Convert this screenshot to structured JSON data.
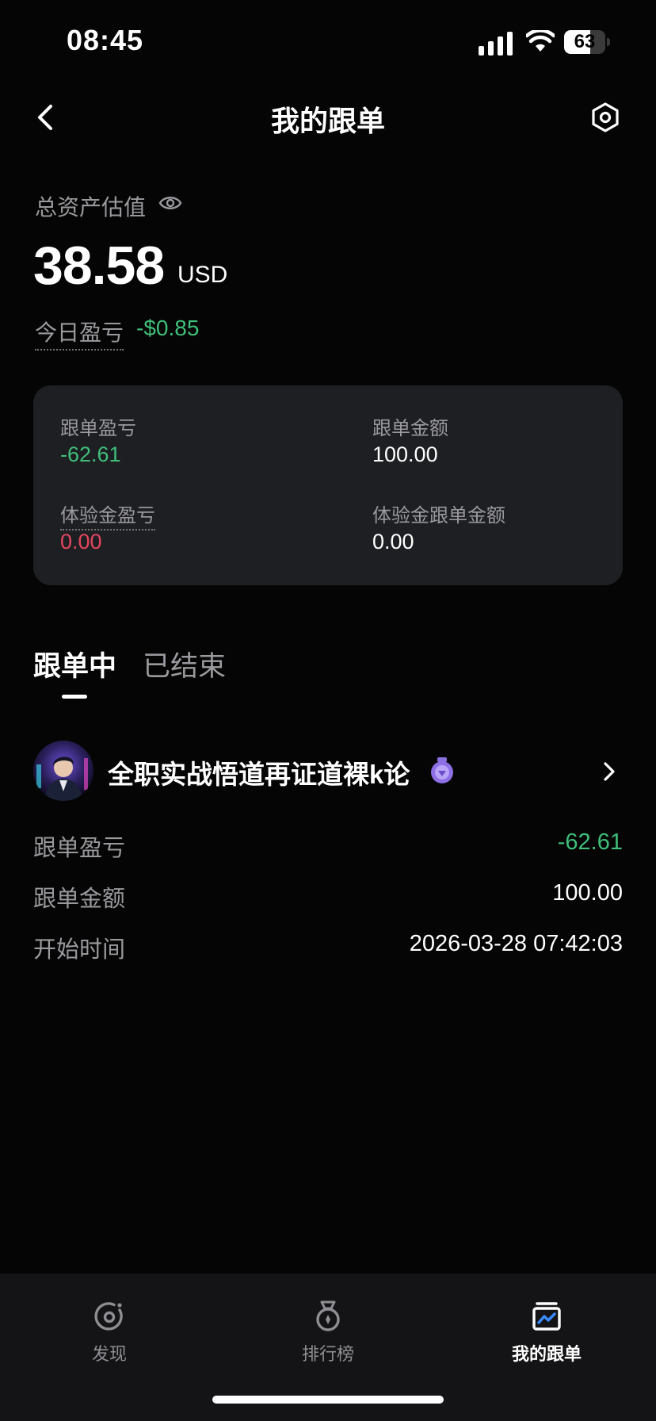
{
  "status_bar": {
    "time": "08:45",
    "battery": "63",
    "battery_level": 0.63
  },
  "header": {
    "title": "我的跟单"
  },
  "assets": {
    "label": "总资产估值",
    "value": "38.58",
    "unit": "USD",
    "today_label": "今日盈亏",
    "today_value": "-$0.85"
  },
  "summary_card": {
    "copy_pnl_label": "跟单盈亏",
    "copy_pnl_value": "-62.61",
    "copy_amount_label": "跟单金额",
    "copy_amount_value": "100.00",
    "trial_pnl_label": "体验金盈亏",
    "trial_pnl_value": "0.00",
    "trial_amount_label": "体验金跟单金额",
    "trial_amount_value": "0.00"
  },
  "tabs": {
    "active": "跟单中",
    "ended": "已结束"
  },
  "trader": {
    "name": "全职实战悟道再证道裸k论",
    "rows": [
      {
        "label": "跟单盈亏",
        "value": "-62.61"
      },
      {
        "label": "跟单金额",
        "value": "100.00"
      },
      {
        "label": "开始时间",
        "value": "2026-03-28 07:42:03"
      }
    ]
  },
  "bottom_tabs": [
    {
      "label": "发现",
      "icon": "discover-icon"
    },
    {
      "label": "排行榜",
      "icon": "leaderboard-icon"
    },
    {
      "label": "我的跟单",
      "icon": "my-copy-icon"
    }
  ],
  "colors": {
    "green": "#3fbf7a",
    "red": "#e5455f",
    "gray": "#9a9a9e",
    "card": "#1e1f22"
  }
}
